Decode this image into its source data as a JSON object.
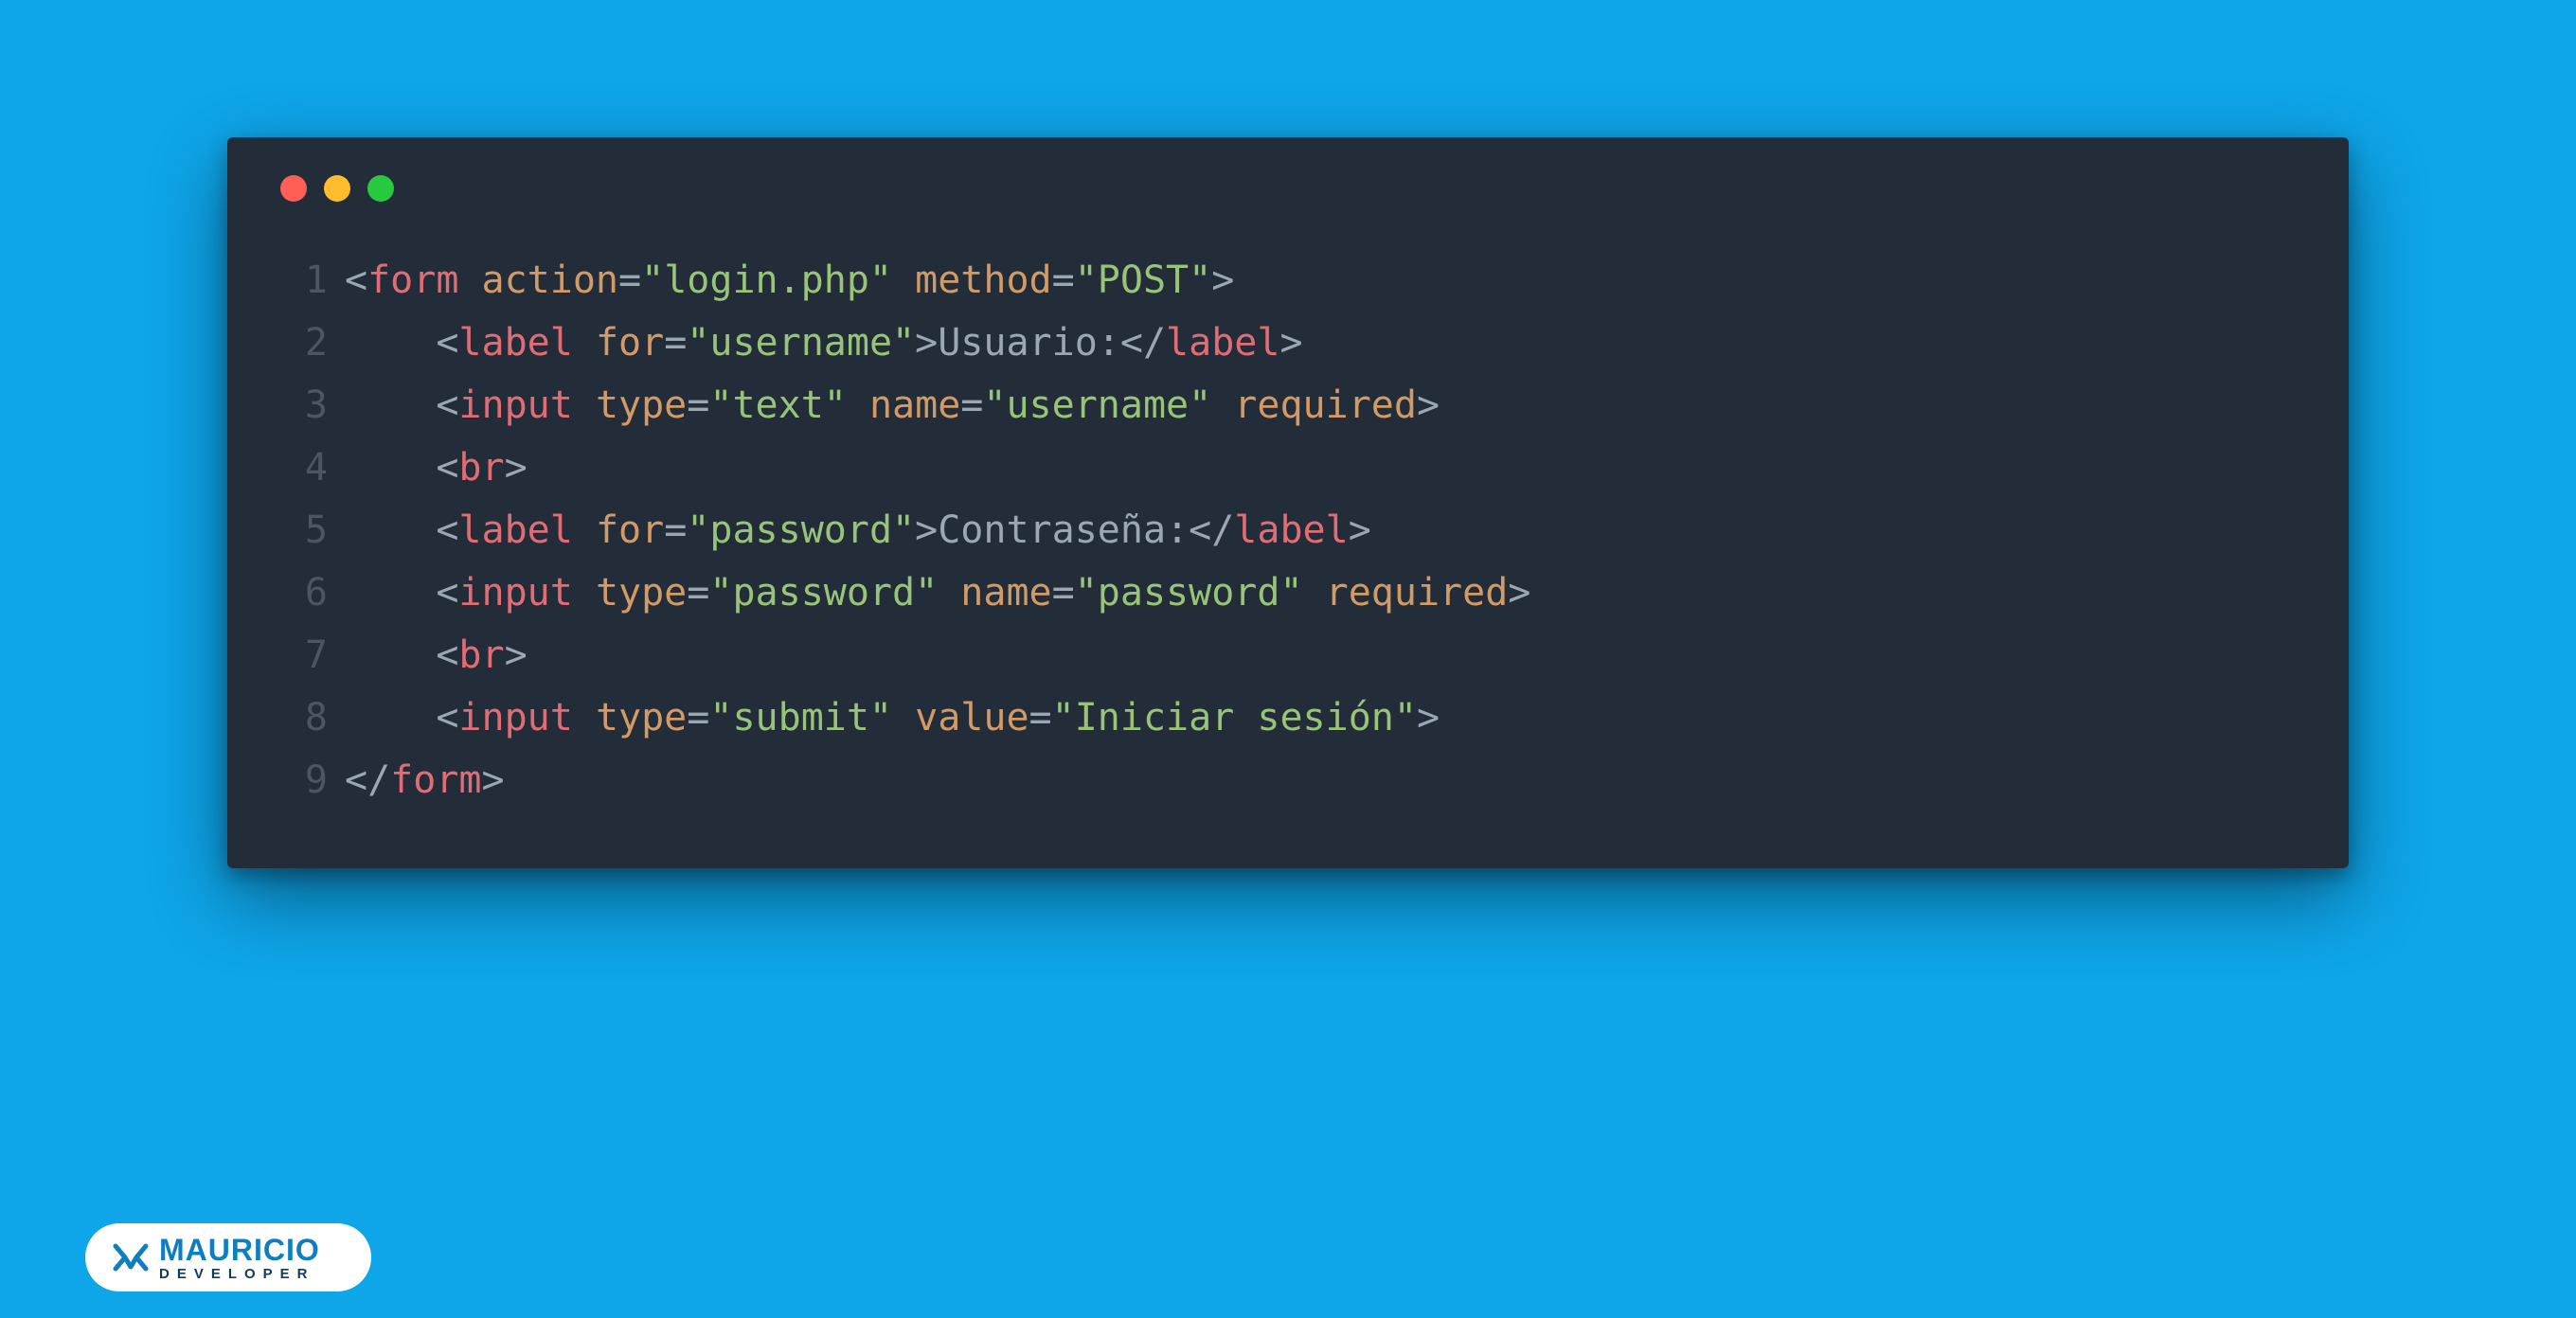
{
  "colors": {
    "background": "#0ea5e9",
    "editor_bg": "#222d39",
    "dot_red": "#ff5f56",
    "dot_yellow": "#ffbd2e",
    "dot_green": "#27c93f",
    "punctuation": "#9aa7b4",
    "tag": "#e06c75",
    "attribute": "#d19a66",
    "string": "#98c379",
    "text": "#9aa7b4",
    "line_number": "#4b5563",
    "logo_primary": "#0e7dc2",
    "logo_secondary": "#153a56"
  },
  "window": {
    "buttons": [
      "close",
      "minimize",
      "zoom"
    ]
  },
  "code": {
    "lines": [
      {
        "n": "1",
        "tokens": [
          {
            "c": "pun",
            "t": "<"
          },
          {
            "c": "tag",
            "t": "form"
          },
          {
            "c": "pun",
            "t": " "
          },
          {
            "c": "attr",
            "t": "action"
          },
          {
            "c": "pun",
            "t": "="
          },
          {
            "c": "str",
            "t": "\"login.php\""
          },
          {
            "c": "pun",
            "t": " "
          },
          {
            "c": "attr",
            "t": "method"
          },
          {
            "c": "pun",
            "t": "="
          },
          {
            "c": "str",
            "t": "\"POST\""
          },
          {
            "c": "pun",
            "t": ">"
          }
        ]
      },
      {
        "n": "2",
        "tokens": [
          {
            "c": "pun",
            "t": "    <"
          },
          {
            "c": "tag",
            "t": "label"
          },
          {
            "c": "pun",
            "t": " "
          },
          {
            "c": "attr",
            "t": "for"
          },
          {
            "c": "pun",
            "t": "="
          },
          {
            "c": "str",
            "t": "\"username\""
          },
          {
            "c": "pun",
            "t": ">"
          },
          {
            "c": "txt",
            "t": "Usuario:"
          },
          {
            "c": "pun",
            "t": "</"
          },
          {
            "c": "tag",
            "t": "label"
          },
          {
            "c": "pun",
            "t": ">"
          }
        ]
      },
      {
        "n": "3",
        "tokens": [
          {
            "c": "pun",
            "t": "    <"
          },
          {
            "c": "tag",
            "t": "input"
          },
          {
            "c": "pun",
            "t": " "
          },
          {
            "c": "attr",
            "t": "type"
          },
          {
            "c": "pun",
            "t": "="
          },
          {
            "c": "str",
            "t": "\"text\""
          },
          {
            "c": "pun",
            "t": " "
          },
          {
            "c": "attr",
            "t": "name"
          },
          {
            "c": "pun",
            "t": "="
          },
          {
            "c": "str",
            "t": "\"username\""
          },
          {
            "c": "pun",
            "t": " "
          },
          {
            "c": "attr",
            "t": "required"
          },
          {
            "c": "pun",
            "t": ">"
          }
        ]
      },
      {
        "n": "4",
        "tokens": [
          {
            "c": "pun",
            "t": "    <"
          },
          {
            "c": "tag",
            "t": "br"
          },
          {
            "c": "pun",
            "t": ">"
          }
        ]
      },
      {
        "n": "5",
        "tokens": [
          {
            "c": "pun",
            "t": "    <"
          },
          {
            "c": "tag",
            "t": "label"
          },
          {
            "c": "pun",
            "t": " "
          },
          {
            "c": "attr",
            "t": "for"
          },
          {
            "c": "pun",
            "t": "="
          },
          {
            "c": "str",
            "t": "\"password\""
          },
          {
            "c": "pun",
            "t": ">"
          },
          {
            "c": "txt",
            "t": "Contraseña:"
          },
          {
            "c": "pun",
            "t": "</"
          },
          {
            "c": "tag",
            "t": "label"
          },
          {
            "c": "pun",
            "t": ">"
          }
        ]
      },
      {
        "n": "6",
        "tokens": [
          {
            "c": "pun",
            "t": "    <"
          },
          {
            "c": "tag",
            "t": "input"
          },
          {
            "c": "pun",
            "t": " "
          },
          {
            "c": "attr",
            "t": "type"
          },
          {
            "c": "pun",
            "t": "="
          },
          {
            "c": "str",
            "t": "\"password\""
          },
          {
            "c": "pun",
            "t": " "
          },
          {
            "c": "attr",
            "t": "name"
          },
          {
            "c": "pun",
            "t": "="
          },
          {
            "c": "str",
            "t": "\"password\""
          },
          {
            "c": "pun",
            "t": " "
          },
          {
            "c": "attr",
            "t": "required"
          },
          {
            "c": "pun",
            "t": ">"
          }
        ]
      },
      {
        "n": "7",
        "tokens": [
          {
            "c": "pun",
            "t": "    <"
          },
          {
            "c": "tag",
            "t": "br"
          },
          {
            "c": "pun",
            "t": ">"
          }
        ]
      },
      {
        "n": "8",
        "tokens": [
          {
            "c": "pun",
            "t": "    <"
          },
          {
            "c": "tag",
            "t": "input"
          },
          {
            "c": "pun",
            "t": " "
          },
          {
            "c": "attr",
            "t": "type"
          },
          {
            "c": "pun",
            "t": "="
          },
          {
            "c": "str",
            "t": "\"submit\""
          },
          {
            "c": "pun",
            "t": " "
          },
          {
            "c": "attr",
            "t": "value"
          },
          {
            "c": "pun",
            "t": "="
          },
          {
            "c": "str",
            "t": "\"Iniciar sesión\""
          },
          {
            "c": "pun",
            "t": ">"
          }
        ]
      },
      {
        "n": "9",
        "tokens": [
          {
            "c": "pun",
            "t": "</"
          },
          {
            "c": "tag",
            "t": "form"
          },
          {
            "c": "pun",
            "t": ">"
          }
        ]
      }
    ]
  },
  "logo": {
    "name": "MAURICIO",
    "subtitle": "DEVELOPER"
  }
}
